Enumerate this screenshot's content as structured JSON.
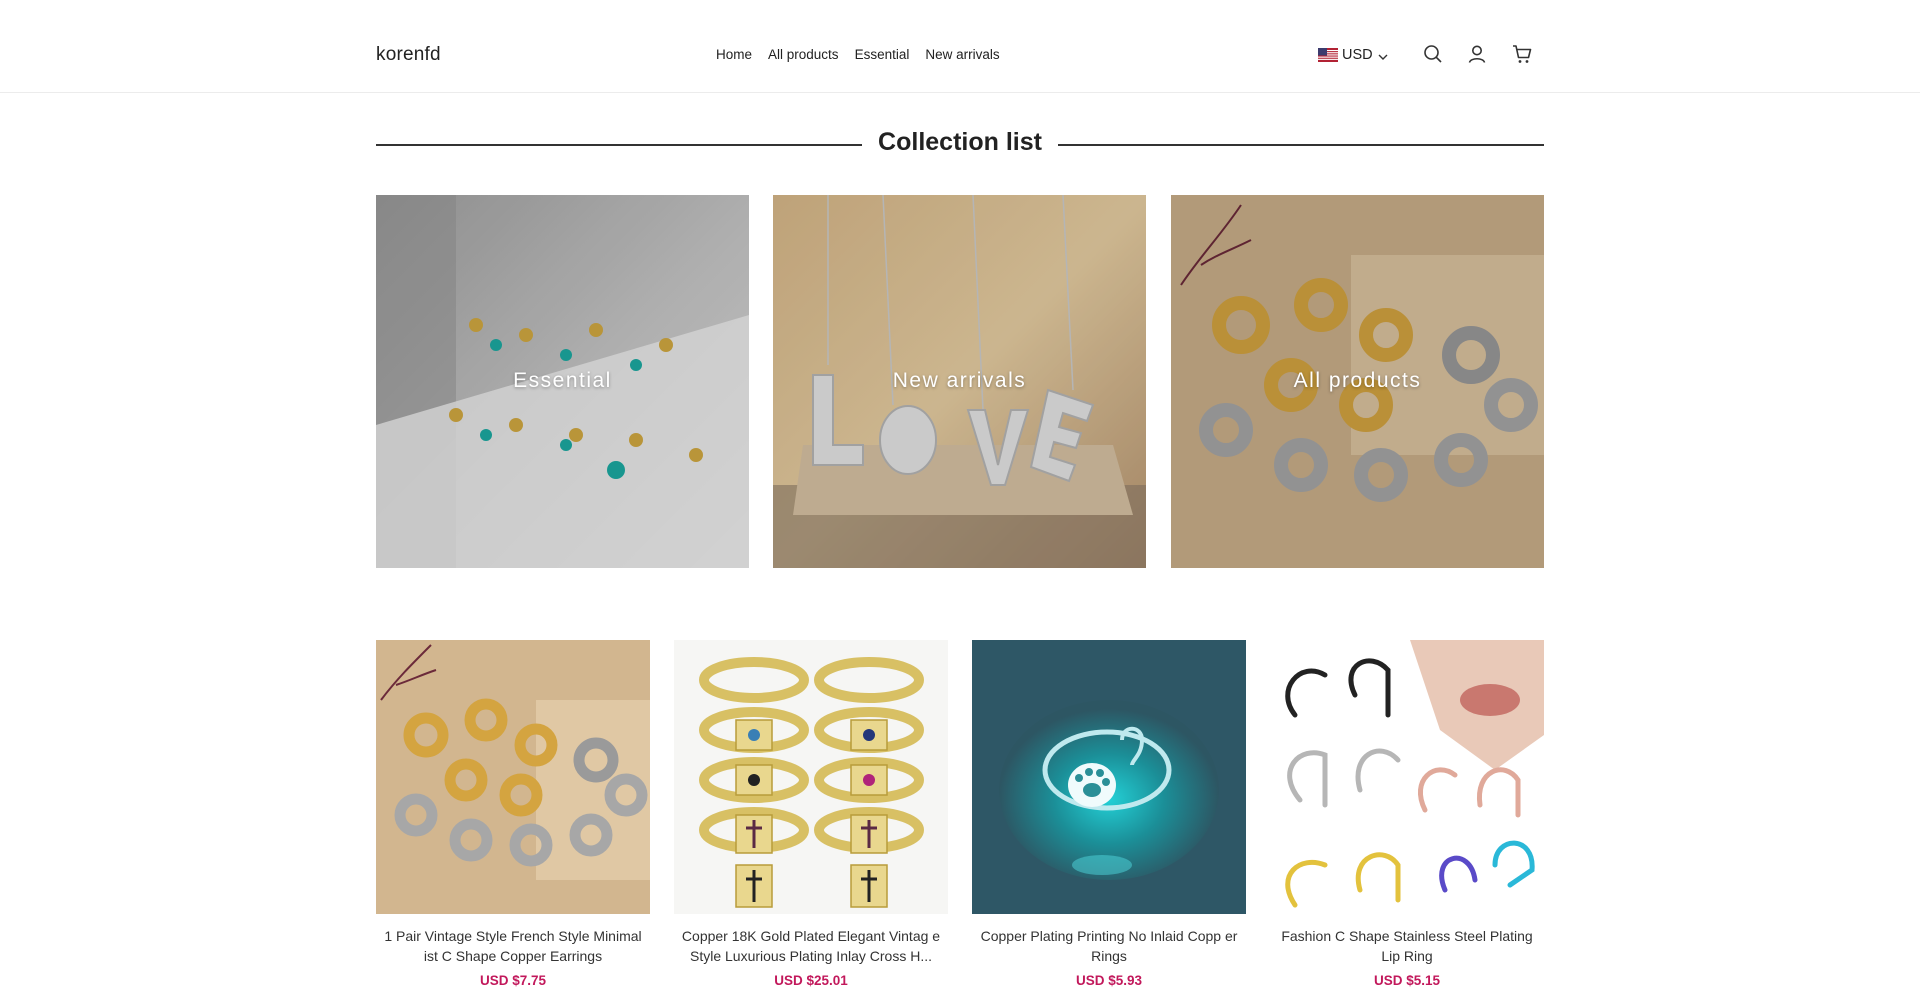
{
  "header": {
    "logo": "korenfd",
    "nav": [
      "Home",
      "All products",
      "Essential",
      "New arrivals"
    ],
    "currency": "USD",
    "icons": [
      "us-flag-icon",
      "chevron-down-icon",
      "search-icon",
      "user-icon",
      "cart-icon"
    ]
  },
  "section": {
    "title": "Collection list"
  },
  "collections": [
    {
      "label": "Essential"
    },
    {
      "label": "New arrivals"
    },
    {
      "label": "All products"
    }
  ],
  "products": [
    {
      "title": "1 Pair Vintage Style French Style Minimal ist C Shape Copper Earrings",
      "price": "USD $7.75"
    },
    {
      "title": "Copper 18K Gold Plated Elegant Vintag e Style Luxurious Plating Inlay Cross H...",
      "price": "USD $25.01"
    },
    {
      "title": "Copper Plating Printing No Inlaid Copp er Rings",
      "price": "USD $5.93"
    },
    {
      "title": "Fashion C Shape Stainless Steel Plating Lip Ring",
      "price": "USD $5.15"
    }
  ],
  "colors": {
    "price": "#c2185b",
    "divider": "#333333"
  }
}
